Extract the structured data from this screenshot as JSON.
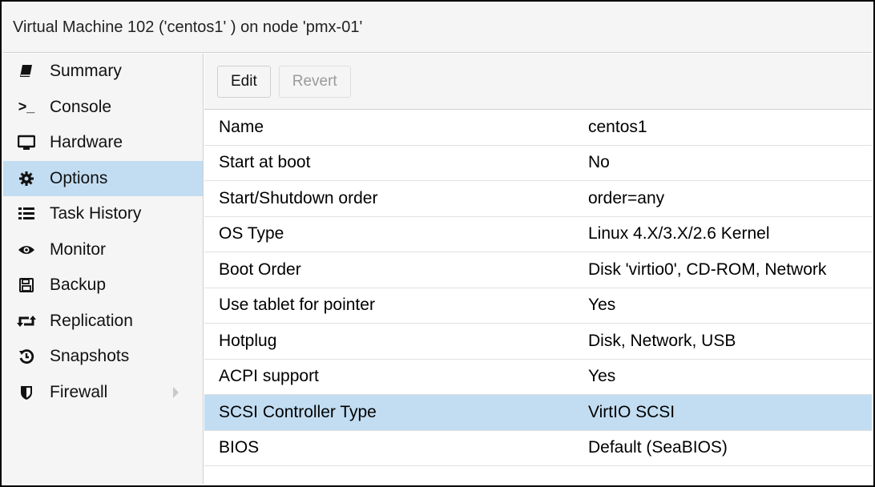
{
  "window": {
    "title": "Virtual Machine 102 ('centos1' ) on node 'pmx-01'"
  },
  "sidebar": {
    "items": [
      {
        "label": "Summary",
        "icon": "book-icon"
      },
      {
        "label": "Console",
        "icon": "terminal-icon"
      },
      {
        "label": "Hardware",
        "icon": "monitor-icon"
      },
      {
        "label": "Options",
        "icon": "gear-icon",
        "selected": true
      },
      {
        "label": "Task History",
        "icon": "list-icon"
      },
      {
        "label": "Monitor",
        "icon": "eye-icon"
      },
      {
        "label": "Backup",
        "icon": "floppy-icon"
      },
      {
        "label": "Replication",
        "icon": "retweet-icon"
      },
      {
        "label": "Snapshots",
        "icon": "history-icon"
      },
      {
        "label": "Firewall",
        "icon": "shield-icon",
        "has_submenu": true
      }
    ]
  },
  "toolbar": {
    "edit_label": "Edit",
    "revert_label": "Revert"
  },
  "options": {
    "rows": [
      {
        "key": "Name",
        "value": "centos1"
      },
      {
        "key": "Start at boot",
        "value": "No"
      },
      {
        "key": "Start/Shutdown order",
        "value": "order=any"
      },
      {
        "key": "OS Type",
        "value": "Linux 4.X/3.X/2.6 Kernel"
      },
      {
        "key": "Boot Order",
        "value": "Disk 'virtio0', CD-ROM, Network"
      },
      {
        "key": "Use tablet for pointer",
        "value": "Yes"
      },
      {
        "key": "Hotplug",
        "value": "Disk, Network, USB"
      },
      {
        "key": "ACPI support",
        "value": "Yes"
      },
      {
        "key": "SCSI Controller Type",
        "value": "VirtIO SCSI",
        "selected": true
      },
      {
        "key": "BIOS",
        "value": "Default (SeaBIOS)"
      }
    ]
  },
  "colors": {
    "selection": "#c2ddf2",
    "panel_bg": "#f5f5f5",
    "border": "#cfcfcf"
  }
}
